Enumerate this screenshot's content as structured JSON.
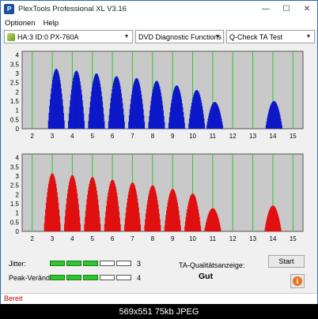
{
  "window": {
    "title": "PlexTools Professional XL V3.16",
    "icon_label": "P",
    "minimize": "—",
    "maximize": "☐",
    "close": "✕"
  },
  "menu": {
    "items": [
      "Optionen",
      "Help"
    ]
  },
  "toolbar": {
    "drive": "HA:3 ID:0  PX-760A",
    "function": "DVD Diagnostic Functions",
    "test": "Q-Check TA Test",
    "dropdown_glyph": "▼"
  },
  "chart_data": [
    {
      "type": "bar",
      "name": "top",
      "color": "#0d19c8",
      "background": "#c9c9c9",
      "gridline_color": "#2fc82f",
      "x_ticks": [
        "2",
        "3",
        "4",
        "5",
        "6",
        "7",
        "8",
        "9",
        "10",
        "11",
        "12",
        "13",
        "14",
        "15"
      ],
      "y_ticks": [
        "4",
        "3.5",
        "3",
        "2.5",
        "2",
        "1.5",
        "1",
        "0.5",
        "0"
      ],
      "xlim": [
        1.5,
        15.5
      ],
      "ylim": [
        0,
        4.2
      ],
      "peaks": [
        {
          "center": 3.2,
          "height": 3.25
        },
        {
          "center": 4.2,
          "height": 3.15
        },
        {
          "center": 5.2,
          "height": 3.0
        },
        {
          "center": 6.2,
          "height": 2.85
        },
        {
          "center": 7.2,
          "height": 2.75
        },
        {
          "center": 8.2,
          "height": 2.6
        },
        {
          "center": 9.2,
          "height": 2.35
        },
        {
          "center": 10.2,
          "height": 2.1
        },
        {
          "center": 11.1,
          "height": 1.45
        },
        {
          "center": 14.05,
          "height": 1.5
        }
      ]
    },
    {
      "type": "bar",
      "name": "bottom",
      "color": "#e01010",
      "background": "#c9c9c9",
      "gridline_color": "#2fc82f",
      "x_ticks": [
        "2",
        "3",
        "4",
        "5",
        "6",
        "7",
        "8",
        "9",
        "10",
        "11",
        "12",
        "13",
        "14",
        "15"
      ],
      "y_ticks": [
        "4",
        "3.5",
        "3",
        "2.5",
        "2",
        "1.5",
        "1",
        "0.5",
        "0"
      ],
      "xlim": [
        1.5,
        15.5
      ],
      "ylim": [
        0,
        4.2
      ],
      "peaks": [
        {
          "center": 3.0,
          "height": 3.15
        },
        {
          "center": 4.0,
          "height": 3.05
        },
        {
          "center": 5.0,
          "height": 2.95
        },
        {
          "center": 6.0,
          "height": 2.8
        },
        {
          "center": 7.0,
          "height": 2.65
        },
        {
          "center": 8.0,
          "height": 2.5
        },
        {
          "center": 9.0,
          "height": 2.3
        },
        {
          "center": 10.0,
          "height": 2.05
        },
        {
          "center": 11.0,
          "height": 1.25
        },
        {
          "center": 14.0,
          "height": 1.4
        }
      ]
    }
  ],
  "bottom": {
    "jitter_label": "Jitter:",
    "jitter_value": "3",
    "jitter_level": 3,
    "peak_label": "Peak-Veränd:",
    "peak_value": "4",
    "peak_level": 3,
    "meter_segments": 5,
    "quality_label": "TA-Qualitätsanzeige:",
    "quality_value": "Gut",
    "start_button": "Start",
    "info_glyph": "i"
  },
  "status": {
    "text": "Bereit"
  },
  "caption": "569x551  75kb  JPEG"
}
